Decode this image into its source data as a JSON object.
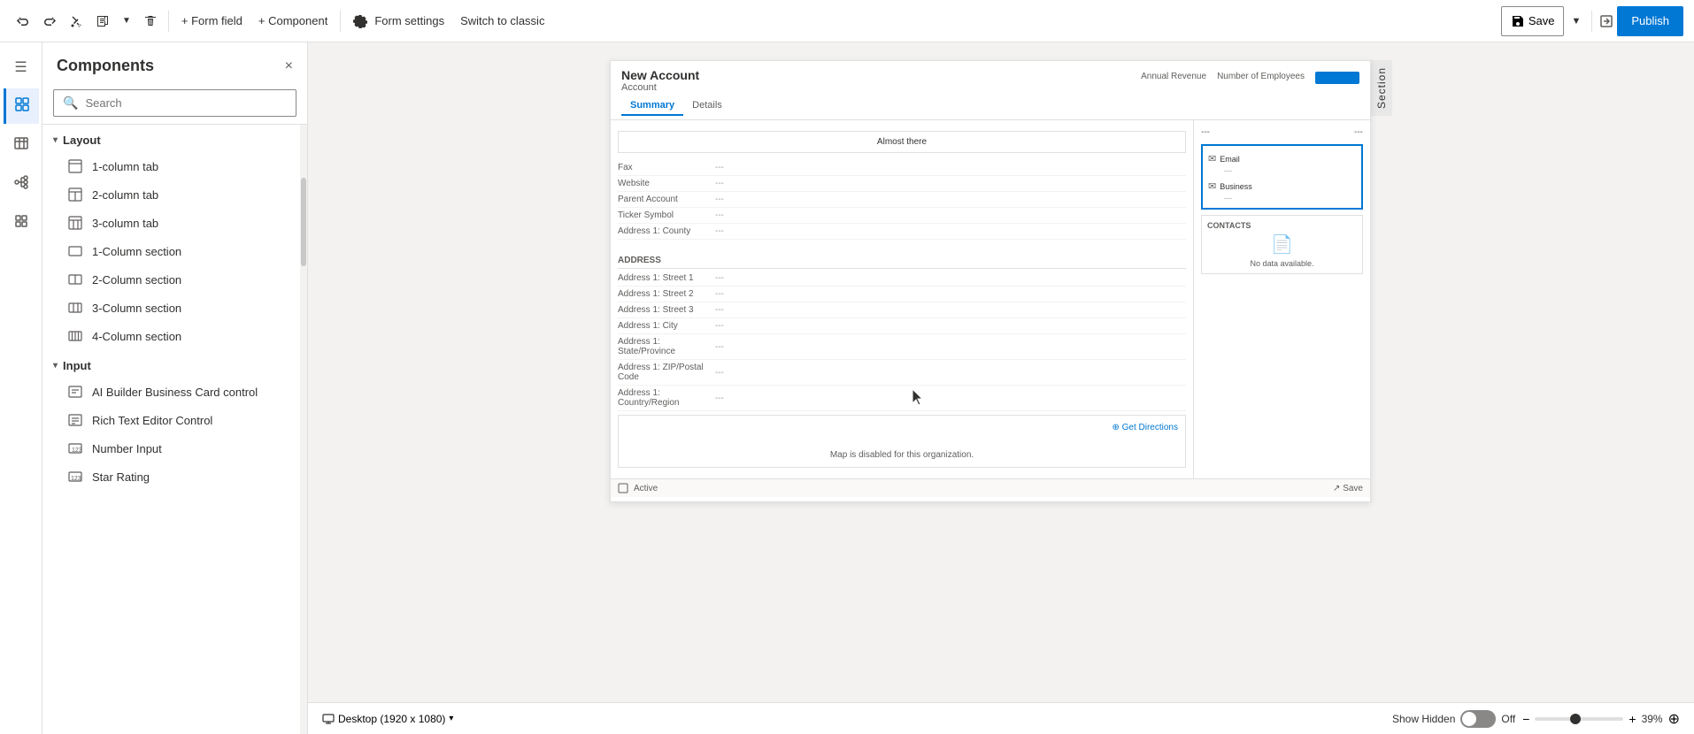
{
  "toolbar": {
    "undo_label": "Undo",
    "redo_label": "Redo",
    "cut_label": "Cut",
    "copy_label": "Copy",
    "delete_label": "Delete",
    "form_field_label": "+ Form field",
    "component_label": "+ Component",
    "form_settings_label": "Form settings",
    "switch_classic_label": "Switch to classic",
    "save_label": "Save",
    "publish_label": "Publish"
  },
  "nav_rail": {
    "items": [
      {
        "id": "menu",
        "icon": "☰",
        "label": ""
      },
      {
        "id": "components",
        "icon": "⬡",
        "label": "Components",
        "active": true
      },
      {
        "id": "table_columns",
        "icon": "Abc",
        "label": "Table columns"
      },
      {
        "id": "tree_view",
        "icon": "◈",
        "label": "Tree view"
      },
      {
        "id": "form_libraries",
        "icon": "⊞",
        "label": "Form libraries"
      }
    ]
  },
  "sidebar": {
    "title": "Components",
    "close_label": "×",
    "search_placeholder": "Search",
    "sections": [
      {
        "id": "layout",
        "label": "Layout",
        "expanded": true,
        "items": [
          {
            "id": "1col_tab",
            "label": "1-column tab",
            "icon": "tab"
          },
          {
            "id": "2col_tab",
            "label": "2-column tab",
            "icon": "tab2"
          },
          {
            "id": "3col_tab",
            "label": "3-column tab",
            "icon": "tab3"
          },
          {
            "id": "1col_section",
            "label": "1-Column section",
            "icon": "sec1"
          },
          {
            "id": "2col_section",
            "label": "2-Column section",
            "icon": "sec2"
          },
          {
            "id": "3col_section",
            "label": "3-Column section",
            "icon": "sec3"
          },
          {
            "id": "4col_section",
            "label": "4-Column section",
            "icon": "sec4"
          }
        ]
      },
      {
        "id": "input",
        "label": "Input",
        "expanded": true,
        "items": [
          {
            "id": "ai_builder",
            "label": "AI Builder Business Card control",
            "icon": "input"
          },
          {
            "id": "rich_text",
            "label": "Rich Text Editor Control",
            "icon": "input"
          },
          {
            "id": "number_input",
            "label": "Number Input",
            "icon": "123"
          },
          {
            "id": "star_rating",
            "label": "Star Rating",
            "icon": "123"
          }
        ]
      }
    ]
  },
  "form_preview": {
    "title": "New Account",
    "subtitle": "Account",
    "tabs": [
      "Summary",
      "Details"
    ],
    "active_tab": "Summary",
    "top_right_labels": [
      "Annual Revenue",
      "Number of Employees"
    ],
    "main_fields": [
      {
        "label": "Fax",
        "value": "---"
      },
      {
        "label": "Website",
        "value": "---"
      },
      {
        "label": "Parent Account",
        "value": "---"
      },
      {
        "label": "Ticker Symbol",
        "value": "---"
      },
      {
        "label": "Address 1: County",
        "value": "---"
      }
    ],
    "address_section_label": "ADDRESS",
    "address_fields": [
      {
        "label": "Address 1: Street 1",
        "value": "---"
      },
      {
        "label": "Address 1: Street 2",
        "value": "---"
      },
      {
        "label": "Address 1: Street 3",
        "value": "---"
      },
      {
        "label": "Address 1: City",
        "value": "---"
      },
      {
        "label": "Address 1: State/Province",
        "value": "---"
      },
      {
        "label": "Address 1: ZIP/Postal Code",
        "value": "---"
      },
      {
        "label": "Address 1: Country/Region",
        "value": "---"
      }
    ],
    "map_text": "Map is disabled for this organization.",
    "get_directions_label": "⊕ Get Directions",
    "almost_there_label": "Almost there",
    "right_panel": {
      "top_labels": [
        "---",
        "---"
      ],
      "email_section": {
        "email_icon": "✉",
        "email_label": "Email",
        "email_value": "---",
        "business_icon": "✉",
        "business_label": "Business",
        "business_value": "---"
      },
      "contacts_section": {
        "title": "CONTACTS",
        "empty_text": "No data available."
      }
    },
    "bottom_left": "⊞ Active",
    "bottom_right": "↗ Save"
  },
  "status_bar": {
    "desktop_label": "Desktop (1920 x 1080)",
    "show_hidden_label": "Show Hidden",
    "toggle_state": "Off",
    "zoom_minus": "−",
    "zoom_plus": "+",
    "zoom_value": "39%",
    "crosshair_icon": "⊕"
  },
  "section_panel": {
    "label": "Section"
  }
}
